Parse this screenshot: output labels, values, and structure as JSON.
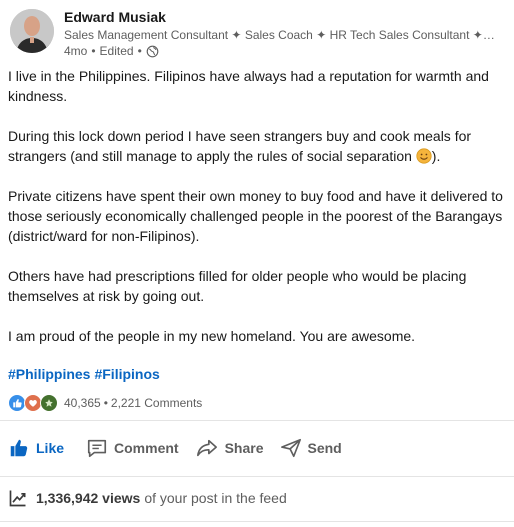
{
  "author": {
    "name": "Edward Musiak",
    "headline": "Sales Management Consultant ✦ Sales Coach ✦ HR Tech Sales Consultant ✦ Gl...",
    "time": "4mo",
    "edited": "Edited",
    "separator": "•"
  },
  "post": {
    "paragraphs": [
      "I live in the Philippines. Filipinos have always had a reputation for warmth and kindness.",
      "During this lock down period I have seen strangers buy and cook meals for strangers (and still manage to apply the rules of social separation",
      "Private citizens have spent their own money to buy food and have it delivered to those seriously economically challenged people in the poorest of the Barangays (district/ward for non-Filipinos).",
      "Others have had prescriptions filled for older people who would be placing themselves at risk by going out.",
      "I am proud of the people in my new homeland. You are awesome."
    ],
    "after_emoji": ").",
    "hashtags": [
      "#Philippines",
      "#Filipinos"
    ]
  },
  "social": {
    "reactions_count": "40,365",
    "separator": "•",
    "comments": "2,221 Comments",
    "reaction_icons": [
      "like-icon",
      "love-icon",
      "support-icon"
    ]
  },
  "actions": {
    "like": "Like",
    "comment": "Comment",
    "share": "Share",
    "send": "Send"
  },
  "views": {
    "count": "1,336,942 views",
    "suffix": "of your post in the feed"
  },
  "colors": {
    "brand_blue": "#0a66c2",
    "muted": "#5e5e5e",
    "divider": "#e4e4e4"
  }
}
